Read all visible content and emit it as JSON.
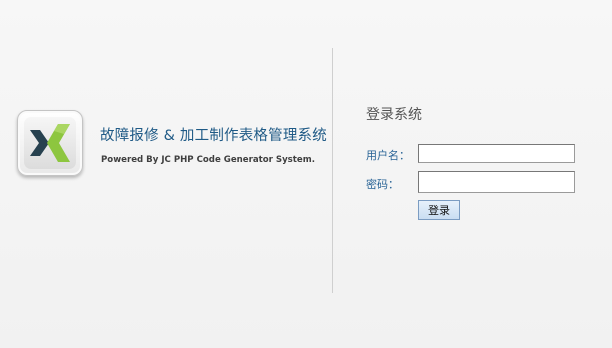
{
  "brand": {
    "logo_icon": "x-chevron-logo-icon",
    "title": "故障报修 & 加工制作表格管理系统",
    "powered_by": "Powered By JC PHP Code Generator  System.",
    "title_color": "#1f5a86"
  },
  "login": {
    "title": "登录系统",
    "username_label": "用户名：",
    "username_value": "",
    "password_label": "密码：",
    "password_value": "",
    "submit_label": "登录",
    "label_color": "#2a6496"
  },
  "colors": {
    "logo_dark": "#27414f",
    "logo_green": "#8dc63f",
    "button_border": "#7b9cc2"
  }
}
